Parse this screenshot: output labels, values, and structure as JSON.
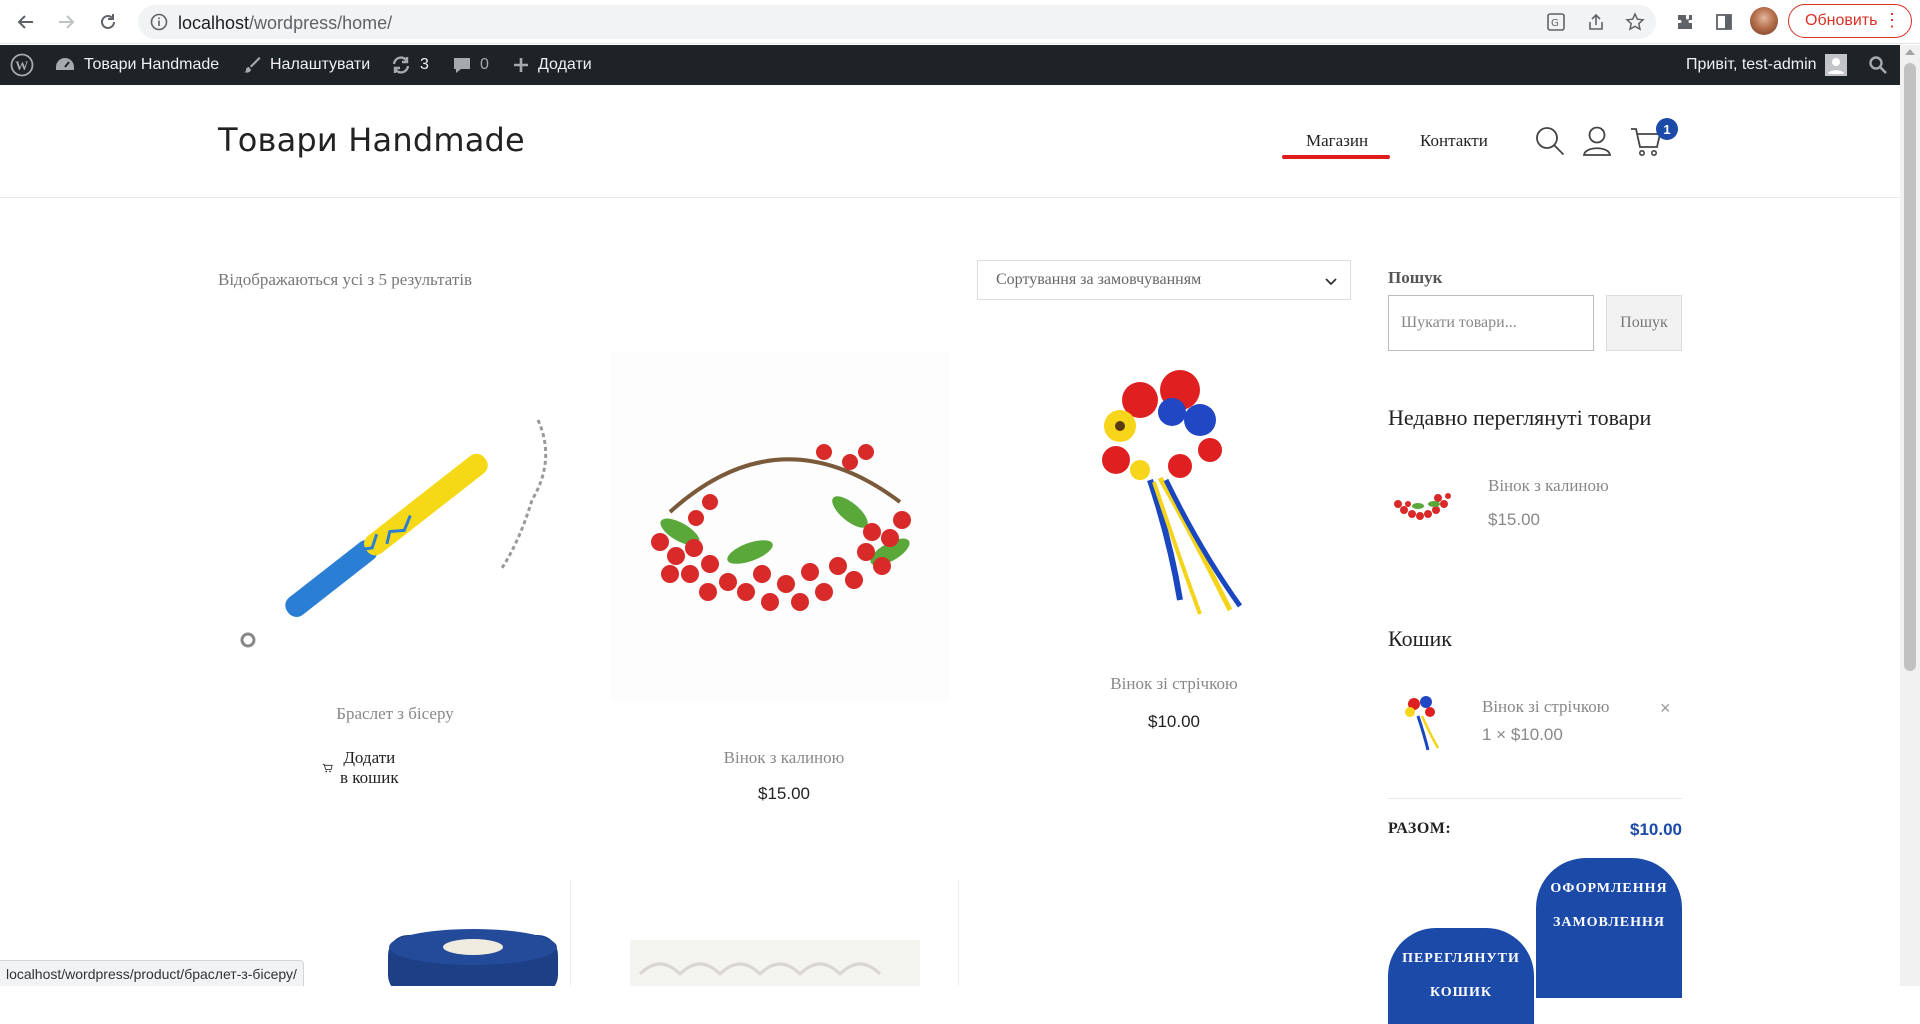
{
  "browser": {
    "url_host": "localhost",
    "url_path": "/wordpress/home/",
    "update_label": "Обновить"
  },
  "adminbar": {
    "site_name": "Товари Handmade",
    "customize": "Налаштувати",
    "updates_count": "3",
    "comments_count": "0",
    "add_new": "Додати",
    "greeting": "Привіт, test-admin"
  },
  "header": {
    "site_title": "Товари Handmade",
    "nav": [
      "Магазин",
      "Контакти"
    ],
    "cart_count": "1"
  },
  "shop": {
    "result_count": "Відображаються усі з 5 результатів",
    "sort_selected": "Сортування за замовчуванням",
    "products": [
      {
        "name": "Браслет з бісеру",
        "price": "",
        "action": "Додати в кошик"
      },
      {
        "name": "Вінок з калиною",
        "price": "$15.00"
      },
      {
        "name": "Вінок зі стрічкою",
        "price": "$10.00"
      }
    ]
  },
  "sidebar": {
    "search_label": "Пошук",
    "search_placeholder": "Шукати товари...",
    "search_button": "Пошук",
    "recent_heading": "Недавно переглянуті товари",
    "recent_item": {
      "name": "Вінок з калиною",
      "price": "$15.00"
    },
    "cart_heading": "Кошик",
    "cart_item": {
      "name": "Вінок зі стрічкою",
      "qty_price": "1 × $10.00",
      "remove": "×"
    },
    "total_label": "РАЗОМ:",
    "total_value": "$10.00",
    "view_cart_btn": "ПЕРЕГЛЯНУТИ КОШИК",
    "checkout_btn": "ОФОРМЛЕННЯ ЗАМОВЛЕННЯ"
  },
  "statusbar": {
    "text": "localhost/wordpress/product/браслет-з-бісеру/"
  },
  "colors": {
    "accent_blue": "#1b4aa8",
    "nav_underline": "#e01b1b",
    "adminbar_bg": "#1d2327"
  }
}
